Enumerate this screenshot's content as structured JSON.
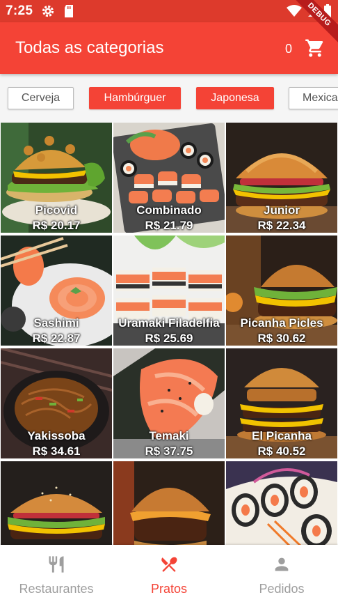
{
  "status": {
    "time": "7:25"
  },
  "debug_banner": "DEBUG",
  "appbar": {
    "title": "Todas as categorias",
    "cart_count": "0"
  },
  "categories": [
    {
      "label": "Cerveja",
      "active": false
    },
    {
      "label": "Hambúrguer",
      "active": true
    },
    {
      "label": "Japonesa",
      "active": true
    },
    {
      "label": "Mexica",
      "active": false
    }
  ],
  "products": [
    {
      "name": "Picovid",
      "price": "R$ 20.17"
    },
    {
      "name": "Combinado",
      "price": "R$ 21.79"
    },
    {
      "name": "Junior",
      "price": "R$ 22.34"
    },
    {
      "name": "Sashimi",
      "price": "R$ 22.87"
    },
    {
      "name": "Uramaki Filadelfia",
      "price": "R$ 25.69"
    },
    {
      "name": "Picanha Picles",
      "price": "R$ 30.62"
    },
    {
      "name": "Yakissoba",
      "price": "R$ 34.61"
    },
    {
      "name": "Temaki",
      "price": "R$ 37.75"
    },
    {
      "name": "El Picanha",
      "price": "R$ 40.52"
    },
    {
      "name": "",
      "price": ""
    },
    {
      "name": "",
      "price": ""
    },
    {
      "name": "",
      "price": ""
    }
  ],
  "nav": [
    {
      "label": "Restaurantes",
      "icon": "fork-knife-icon",
      "active": false
    },
    {
      "label": "Pratos",
      "icon": "utensils-cross-icon",
      "active": true
    },
    {
      "label": "Pedidos",
      "icon": "person-icon",
      "active": false
    }
  ],
  "colors": {
    "primary": "#f44336",
    "status": "#dd3a2c",
    "inactive": "#9e9e9e"
  }
}
